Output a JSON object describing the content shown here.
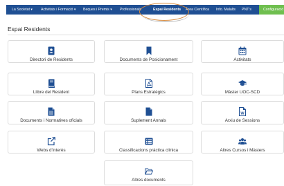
{
  "nav": {
    "items": [
      {
        "label": "La Societat ▾"
      },
      {
        "label": "Activitats i Formació ▾"
      },
      {
        "label": "Beques i Premis ▾"
      },
      {
        "label": "Professionals"
      },
      {
        "label": "Espai Residents"
      },
      {
        "label": "Àrea Científica"
      },
      {
        "label": "Info. Malalts"
      },
      {
        "label": "PNT's"
      },
      {
        "label": "Configuració"
      }
    ]
  },
  "page": {
    "title": "Espai Residents"
  },
  "cards": [
    {
      "label": "Directori de Residents",
      "icon": "contact-card-icon"
    },
    {
      "label": "Documents de Posicionament",
      "icon": "bookmark-icon"
    },
    {
      "label": "Activitats",
      "icon": "calendar-icon"
    },
    {
      "label": "Llibre del Resident",
      "icon": "book-icon"
    },
    {
      "label": "Plans Estratègics",
      "icon": "pdf-file-icon"
    },
    {
      "label": "Màster UOC-SCD",
      "icon": "graduation-cap-icon"
    },
    {
      "label": "Documents i Normatives oficials",
      "icon": "document-text-icon"
    },
    {
      "label": "Suplement Annals",
      "icon": "document-icon"
    },
    {
      "label": "Arxiu de Sessions",
      "icon": "word-file-icon"
    },
    {
      "label": "Webs d'interès",
      "icon": "external-link-icon"
    },
    {
      "label": "Classificacions pràctica clínica",
      "icon": "list-icon"
    },
    {
      "label": "Altres Cursos i Màsters",
      "icon": "users-icon"
    },
    {
      "label": "Altres documents",
      "icon": "folder-open-icon"
    }
  ],
  "colors": {
    "navbar": "#1f4f93",
    "active_tab": "#6fbf4f",
    "icon": "#1f4f93",
    "highlight_oval": "#d88a3c"
  }
}
